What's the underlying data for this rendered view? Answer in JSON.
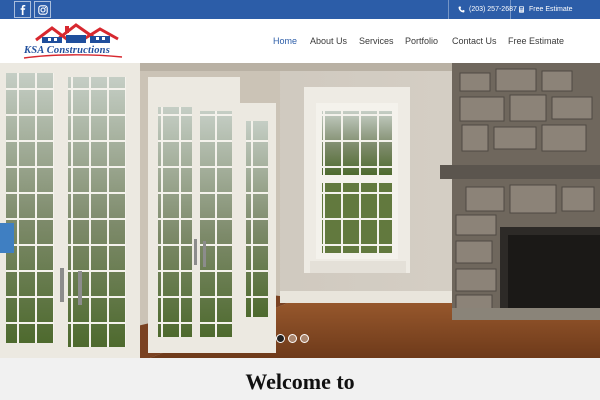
{
  "topbar": {
    "background": "#2c5da8",
    "social": [
      {
        "icon": "facebook-icon"
      },
      {
        "icon": "instagram-icon"
      }
    ],
    "phone": {
      "icon": "phone-icon",
      "text": "(203) 257-2687"
    },
    "estimate": {
      "icon": "calculator-icon",
      "text": "Free Estimate"
    }
  },
  "header": {
    "logo_text": "KSA Constructions",
    "nav": [
      {
        "label": "Home",
        "active": true
      },
      {
        "label": "About Us",
        "active": false
      },
      {
        "label": "Services",
        "active": false
      },
      {
        "label": "Portfolio",
        "active": false
      },
      {
        "label": "Contact Us",
        "active": false
      },
      {
        "label": "Free Estimate",
        "active": false
      }
    ],
    "accent": "#2c5da8"
  },
  "slider": {
    "slide_count": 3,
    "active_index": 0
  },
  "welcome": {
    "title": "Welcome to"
  }
}
